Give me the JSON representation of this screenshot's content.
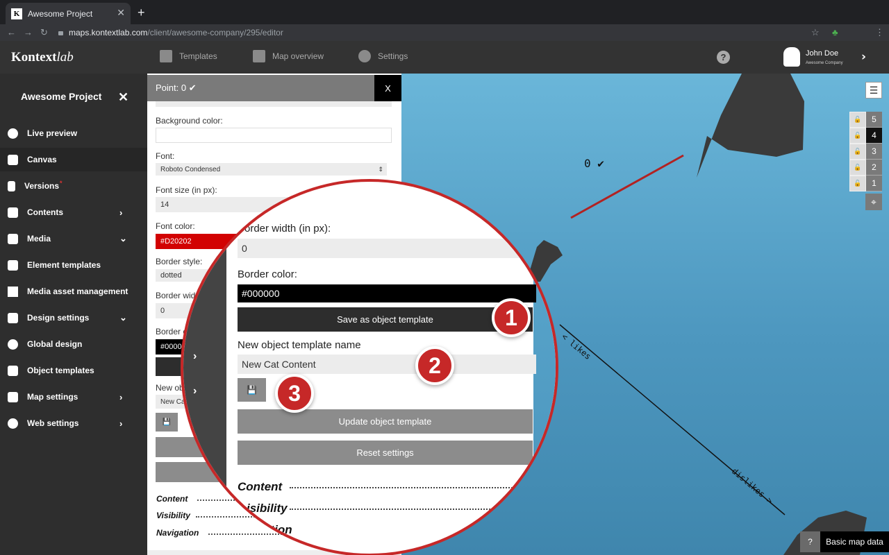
{
  "browser": {
    "tab_title": "Awesome Project",
    "tab_favicon": "K",
    "url_host": "maps.kontextlab.com",
    "url_path": "/client/awesome-company/295/editor"
  },
  "header": {
    "logo_main": "Kontext",
    "logo_italic": "lab",
    "nav": [
      {
        "label": "Templates",
        "icon": "templates-icon"
      },
      {
        "label": "Map overview",
        "icon": "grid-icon"
      },
      {
        "label": "Settings",
        "icon": "gear-icon"
      }
    ],
    "help": "?",
    "user_name": "John Doe",
    "user_company": "Awesome Company"
  },
  "sidebar": {
    "project_title": "Awesome Project",
    "close": "✕",
    "items": [
      {
        "label": "Live preview",
        "icon": "eye-icon"
      },
      {
        "label": "Canvas",
        "icon": "edit-icon"
      },
      {
        "label": "Versions",
        "icon": "branch-icon"
      },
      {
        "label": "Contents",
        "icon": "folder-icon"
      },
      {
        "label": "Media",
        "icon": "media-icon"
      },
      {
        "label": "Element templates",
        "icon": "cube-icon"
      },
      {
        "label": "Media asset management",
        "icon": "grid-icon"
      },
      {
        "label": "Design settings",
        "icon": "brush-icon"
      },
      {
        "label": "Global design",
        "icon": "palette-icon"
      },
      {
        "label": "Object templates",
        "icon": "object-icon"
      },
      {
        "label": "Map settings",
        "icon": "map-icon"
      },
      {
        "label": "Web settings",
        "icon": "globe-icon"
      }
    ]
  },
  "panel": {
    "title": "Point: 0 ✔",
    "close": "X",
    "background_color_label": "Background color:",
    "font_label": "Font:",
    "font_value": "Roboto Condensed",
    "font_size_label": "Font size (in px):",
    "font_size_value": "14",
    "font_color_label": "Font color:",
    "font_color_value": "#D20202",
    "border_style_label": "Border style:",
    "border_style_value": "dotted",
    "border_width_label": "Border widt",
    "border_width_value": "0",
    "border_color_label": "Border c",
    "border_color_value": "#00000",
    "new_obj_label": "New obj",
    "new_obj_value": "New Cat",
    "save_icon": "💾",
    "sections": [
      "Content",
      "Visibility",
      "Navigation"
    ]
  },
  "zoom": {
    "border_width_label": "Border width (in px):",
    "border_width_value": "0",
    "border_color_label": "Border color:",
    "border_color_value": "#000000",
    "save_template_button": "Save as object template",
    "new_template_name_label": "New object template name",
    "new_template_name_value": "New Cat Content",
    "save_icon": "💾",
    "update_template_button": "Update object template",
    "reset_button": "Reset settings",
    "sections": [
      "Content",
      "Visibility",
      "Navigation"
    ],
    "section_display": [
      "Content",
      "isibility",
      "ation"
    ],
    "badges": [
      "1",
      "2",
      "3"
    ]
  },
  "map": {
    "point_label": "0 ✔",
    "axis_likes": "< likes",
    "axis_dislikes": "dislikes >",
    "layers": [
      "5",
      "4",
      "3",
      "2",
      "1"
    ],
    "current_layer": "4",
    "footer_help": "?",
    "footer_label": "Basic map data"
  },
  "colors": {
    "accent_red": "#c62828",
    "font_red": "#D20202",
    "sidebar_bg": "#2e2e2e",
    "map_blue": "#4d97bf"
  }
}
